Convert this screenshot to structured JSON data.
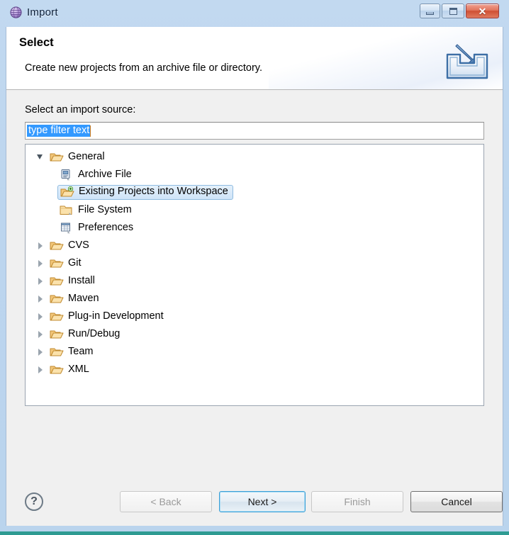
{
  "window": {
    "title": "Import",
    "title_icon": "eclipse-import-sphere-icon",
    "controls": {
      "minimize": "minimize-icon",
      "maximize": "maximize-icon",
      "close": "✕"
    }
  },
  "header": {
    "title": "Select",
    "description": "Create new projects from an archive file or directory.",
    "icon": "import-arrow-into-tray-icon"
  },
  "body": {
    "field_label": "Select an import source:",
    "filter": {
      "value": "type filter text",
      "placeholder": "type filter text",
      "selected": true
    },
    "tree": [
      {
        "label": "General",
        "icon": "open-folder-icon",
        "level": 0,
        "state": "expanded",
        "selected": false
      },
      {
        "label": "Archive File",
        "icon": "archive-file-icon",
        "level": 1,
        "state": "leaf",
        "selected": false
      },
      {
        "label": "Existing Projects into Workspace",
        "icon": "import-project-folder-icon",
        "level": 1,
        "state": "leaf",
        "selected": true
      },
      {
        "label": "File System",
        "icon": "folder-icon",
        "level": 1,
        "state": "leaf",
        "selected": false
      },
      {
        "label": "Preferences",
        "icon": "preferences-grid-icon",
        "level": 1,
        "state": "leaf",
        "selected": false
      },
      {
        "label": "CVS",
        "icon": "open-folder-icon",
        "level": 0,
        "state": "collapsed",
        "selected": false
      },
      {
        "label": "Git",
        "icon": "open-folder-icon",
        "level": 0,
        "state": "collapsed",
        "selected": false
      },
      {
        "label": "Install",
        "icon": "open-folder-icon",
        "level": 0,
        "state": "collapsed",
        "selected": false
      },
      {
        "label": "Maven",
        "icon": "open-folder-icon",
        "level": 0,
        "state": "collapsed",
        "selected": false
      },
      {
        "label": "Plug-in Development",
        "icon": "open-folder-icon",
        "level": 0,
        "state": "collapsed",
        "selected": false
      },
      {
        "label": "Run/Debug",
        "icon": "open-folder-icon",
        "level": 0,
        "state": "collapsed",
        "selected": false
      },
      {
        "label": "Team",
        "icon": "open-folder-icon",
        "level": 0,
        "state": "collapsed",
        "selected": false
      },
      {
        "label": "XML",
        "icon": "open-folder-icon",
        "level": 0,
        "state": "collapsed",
        "selected": false
      }
    ]
  },
  "footer": {
    "help_label": "?",
    "help_icon": "question-mark-circle-icon",
    "buttons": {
      "back": "< Back",
      "next": "Next >",
      "finish": "Finish",
      "cancel": "Cancel"
    },
    "states": {
      "back": "disabled",
      "next": "default-focused",
      "finish": "disabled",
      "cancel": "enabled"
    }
  },
  "colors": {
    "selection_blue": "#3399ff",
    "tree_selection_fill": "#cfe4f8",
    "tree_selection_border": "#8fbbe0",
    "focus_ring": "#3c9fd6",
    "title_bar": "#bad4ed",
    "dialog_bg": "#f0f0f0"
  }
}
